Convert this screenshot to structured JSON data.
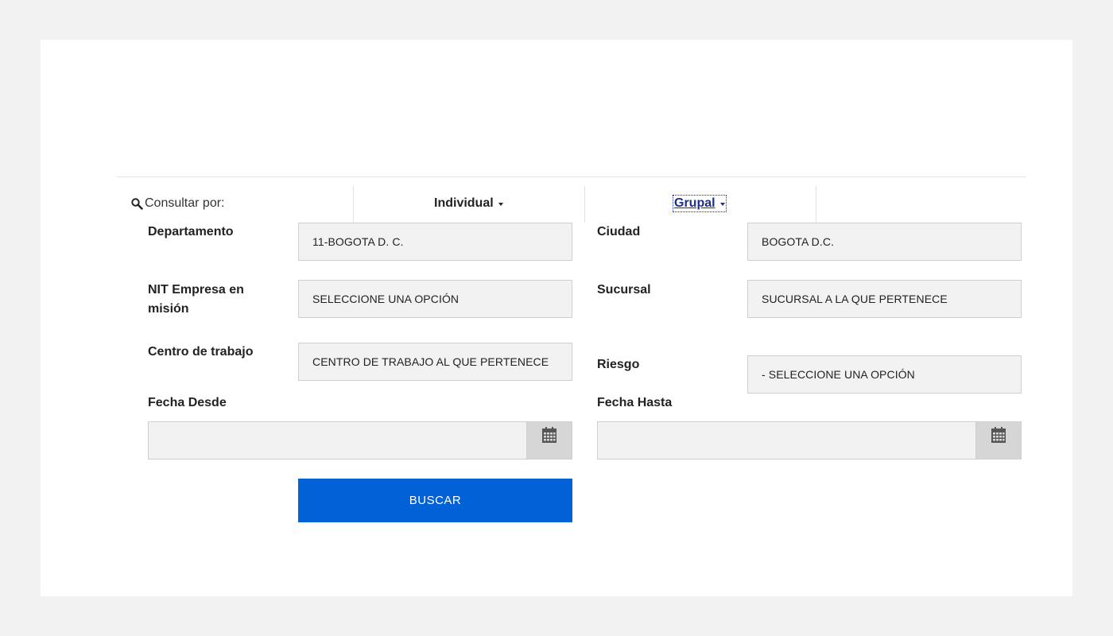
{
  "filter": {
    "consult_label": "Consultar por:",
    "tabs": [
      {
        "label": "Individual",
        "active": false
      },
      {
        "label": "Grupal",
        "active": true
      }
    ]
  },
  "form": {
    "departamento": {
      "label": "Departamento",
      "value": "11-BOGOTA D. C."
    },
    "ciudad": {
      "label": "Ciudad",
      "value": "BOGOTA D.C."
    },
    "nit": {
      "label_line1": "NIT Empresa en",
      "label_line2": "misión",
      "value": "SELECCIONE UNA OPCIÓN"
    },
    "sucursal": {
      "label": "Sucursal",
      "value": "SUCURSAL A LA QUE PERTENECE"
    },
    "centro": {
      "label": "Centro de trabajo",
      "value": "CENTRO DE TRABAJO AL QUE PERTENECE"
    },
    "riesgo": {
      "label": "Riesgo",
      "value": "- SELECCIONE UNA OPCIÓN"
    },
    "fecha_desde": {
      "label": "Fecha Desde",
      "value": ""
    },
    "fecha_hasta": {
      "label": "Fecha Hasta",
      "value": ""
    }
  },
  "actions": {
    "search_label": "BUSCAR"
  },
  "icons": {
    "search": "search-icon",
    "calendar": "calendar-icon",
    "caret": "caret-down-icon"
  },
  "colors": {
    "primary_button": "#0062d6",
    "active_tab": "#1c2f8a",
    "field_bg": "#f2f2f2"
  }
}
